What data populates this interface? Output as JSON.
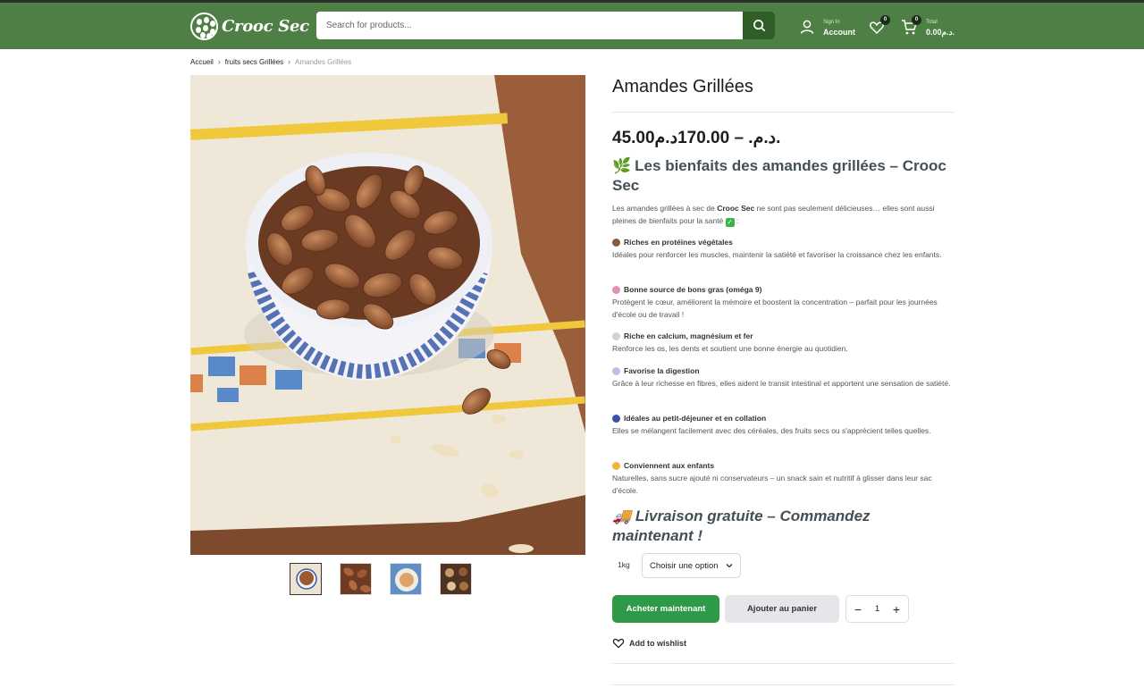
{
  "header": {
    "logo_text": "Crooc Sec",
    "search_placeholder": "Search for products...",
    "account_small": "Sign In",
    "account_label": "Account",
    "wishlist_count": "0",
    "cart_count": "0",
    "cart_small": "Total",
    "cart_total": "0.00د.م."
  },
  "breadcrumb": {
    "items": [
      "Accueil",
      "fruits secs Grillées"
    ],
    "current": "Amandes Grillées"
  },
  "product": {
    "title": "Amandes Grillées",
    "price": "45.00د.م. – 170.00د.م.",
    "heading_icon": "🌿",
    "heading": "Les bienfaits des amandes grillées – Crooc Sec",
    "intro_before": "Les amandes grillées à sec de ",
    "intro_brand": "Crooc Sec",
    "intro_after": " ne sont pas seulement délicieuses… elles sont aussi pleines de bienfaits pour la santé",
    "intro_end": " :",
    "benefits": [
      {
        "title": "Riches en protéines végétales",
        "desc": "Idéales pour renforcer les muscles, maintenir la satiété et favoriser la croissance chez les enfants.",
        "icon_color": "#8a5a3c",
        "icon": "almond-icon"
      },
      {
        "title": "Bonne source de bons gras (oméga 9)",
        "desc": "Protègent le cœur, améliorent la mémoire et boostent la concentration – parfait pour les journées d'école ou de travail !",
        "icon_color": "#e58fb8",
        "icon": "brain-icon"
      },
      {
        "title": "Riche en calcium, magnésium et fer",
        "desc": "Renforce les os, les dents et soutient une bonne énergie au quotidien.",
        "icon_color": "#cfd3d8",
        "icon": "bone-icon"
      },
      {
        "title": "Favorise la digestion",
        "desc": "Grâce à leur richesse en fibres, elles aident le transit intestinal et apportent une sensation de satiété.",
        "icon_color": "#c9b8e6",
        "icon": "utensils-icon"
      },
      {
        "title": "Idéales au petit-déjeuner et en collation",
        "desc": "Elles se mélangent facilement avec des céréales, des fruits secs ou s'apprécient telles quelles.",
        "icon_color": "#3a4fa8",
        "icon": "bowl-icon"
      },
      {
        "title": "Conviennent aux enfants",
        "desc": "Naturelles, sans sucre ajouté ni conservateurs – un snack sain et nutritif à glisser dans leur sac d'école.",
        "icon_color": "#f2b53a",
        "icon": "hand-icon"
      }
    ],
    "delivery_icon": "🚚",
    "delivery": "Livraison gratuite – Commandez maintenant !",
    "option_label": "1kg",
    "option_select": "Choisir une option",
    "buy_label": "Acheter maintenant",
    "add_cart_label": "Ajouter au panier",
    "quantity": "1",
    "minus": "−",
    "plus": "+",
    "wishlist_label": "Add to wishlist"
  },
  "colors": {
    "header_green": "#4e7f44",
    "search_button": "#2f5f26",
    "buy_button": "#2e9a47"
  }
}
